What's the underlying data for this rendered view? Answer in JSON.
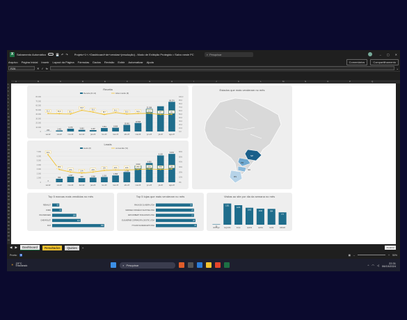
{
  "titlebar": {
    "autosave": "Salvamento Automático",
    "title": "Projeto+1+-+Dashboard+de+vendas+(resolução) - Modo de Exibição Protegido • Salvo neste PC",
    "search_placeholder": "Pesquisar",
    "minimize": "–",
    "maximize": "▢",
    "close": "✕"
  },
  "ribbon": {
    "tabs": [
      "Arquivo",
      "Página Inicial",
      "Inserir",
      "Layout da Página",
      "Fórmulas",
      "Dados",
      "Revisão",
      "Exibir",
      "Automatizar",
      "Ajuda"
    ],
    "comments": "Comentários",
    "share": "Compartilhamento"
  },
  "formula": {
    "namebox": "R26",
    "fx": "fx",
    "content": ""
  },
  "columns": [
    "A",
    "B",
    "C",
    "D",
    "E",
    "F",
    "G",
    "H",
    "I",
    "J",
    "K",
    "L",
    "M",
    "N",
    "O",
    "P",
    "Q"
  ],
  "rows": [
    "1",
    "2",
    "3",
    "4",
    "5",
    "6",
    "7",
    "8",
    "9",
    "10",
    "11",
    "12",
    "13",
    "14",
    "15",
    "16",
    "17",
    "18",
    "19",
    "20",
    "21",
    "22",
    "23",
    "24",
    "25",
    "26",
    "27",
    "28",
    "29",
    "30",
    "31",
    "32",
    "33",
    "34",
    "35",
    "36",
    "37",
    "38",
    "39",
    "40",
    "41",
    "42",
    "43",
    "44"
  ],
  "chart_data": [
    {
      "type": "bar",
      "title": "Receita",
      "categories": [
        "set-22",
        "out-22",
        "nov-22",
        "dez-22",
        "jan-23",
        "fev-23",
        "mar-23",
        "abr-23",
        "mai-23",
        "jun-23",
        "jul-23",
        "ago-23"
      ],
      "series": [
        {
          "name": "Receita (€ mil)",
          "values": [
            234,
            2401,
            6378,
            3663,
            3187,
            7951,
            8608,
            15081,
            19508,
            51984,
            58000,
            68174
          ]
        },
        {
          "name": "ticket médio (€)",
          "values": [
            51.6,
            50.9,
            50.1,
            60.8,
            55.6,
            48.7,
            54.3,
            50.0,
            51.5,
            52.5,
            48.7,
            49.1
          ]
        }
      ],
      "labels": [
        "234",
        "2.401",
        "6.378",
        "3.663",
        "3.187",
        "7.951",
        "8.608",
        "15.081",
        "19.508",
        "51.984",
        "",
        "68.174"
      ],
      "ticket_labels": [
        "51,6",
        "50,9",
        "50,1",
        "60,8",
        "55,6",
        "48,7",
        "54,3",
        "50,0",
        "51,5",
        "52,5",
        "48,7",
        "49,1"
      ],
      "yaxis_left": [
        "80.000",
        "70.000",
        "60.000",
        "50.000",
        "40.000",
        "30.000",
        "20.000",
        "10.000",
        "0"
      ],
      "yaxis_right": [
        "100,0",
        "90,0",
        "80,0",
        "70,0",
        "60,0",
        "50,0",
        "40,0",
        "30,0",
        "20,0",
        "10,0",
        "0,0"
      ]
    },
    {
      "type": "bar",
      "title": "Leads",
      "categories": [
        "set-22",
        "out-22",
        "nov-22",
        "dez-22",
        "jan-23",
        "fev-23",
        "mar-23",
        "abr-23",
        "mai-23",
        "jun-23",
        "jul-23",
        "ago-23"
      ],
      "series": [
        {
          "name": "leads (#)",
          "values": [
            4,
            808,
            1297,
            948,
            1068,
            1193,
            1555,
            2335,
            3819,
            4400,
            6130,
            6491
          ]
        },
        {
          "name": "conversão (%)",
          "values": [
            54,
            25,
            20,
            18,
            20,
            23,
            24,
            24,
            25,
            26,
            25,
            26
          ]
        }
      ],
      "yaxis_left": [
        "7.000",
        "6.000",
        "5.000",
        "4.000",
        "3.000",
        "2.000",
        "1.000",
        "0"
      ],
      "yaxis_right": [
        "60%",
        "50%",
        "40%",
        "30%",
        "20%",
        "10%",
        "0%"
      ]
    },
    {
      "type": "bar",
      "title": "Top 5 marcas mais vendidas no mês",
      "categories": [
        "RENAULT",
        "FORD",
        "VOLKSWAGEN",
        "CHEVROLET",
        "FIAT"
      ],
      "values": [
        53,
        72,
        180,
        212,
        388
      ]
    },
    {
      "type": "bar",
      "title": "Top 5 lojas que mais venderam no mês",
      "categories": [
        "RAUN DE OLIVEIRA LTDA",
        "MARCELO ROGÉLIO SALTOSE LTDA",
        "ARIS ROBERT STALGONOS LTDA",
        "GUILHERME CORRADOR LOGISTIC LTDA",
        "HYGOR OLIVEIRA EPP LTDA"
      ],
      "values": [
        26,
        27,
        27,
        28,
        29
      ]
    },
    {
      "type": "bar",
      "title": "Visitas ao site por dia da semana no mês",
      "categories": [
        "domingo",
        "segunda",
        "terça",
        "quarta",
        "quinta",
        "sexta",
        "sábado"
      ],
      "values": [
        23,
        1331,
        1226,
        1065,
        1010,
        994,
        777
      ]
    }
  ],
  "map": {
    "title": "Estados que mais venderam no mês",
    "labels": [
      "SP",
      "RS",
      "SC",
      "PR"
    ]
  },
  "sheet_tabs": [
    "Dashboard",
    "Resultados",
    "Quiries"
  ],
  "status": {
    "ready": "Pronto",
    "zoom": "50%"
  },
  "tooltip": "Atualizar",
  "taskbar": {
    "weather_temp": "23°C",
    "weather_desc": "Ensolarado",
    "search": "Pesquisar",
    "time": "22:31",
    "date": "06/10/2024"
  },
  "colors": {
    "bar": "#1f6d8c",
    "line": "#f2c22e",
    "map_dark": "#1a5f8a",
    "map_light": "#b6d3e8"
  }
}
